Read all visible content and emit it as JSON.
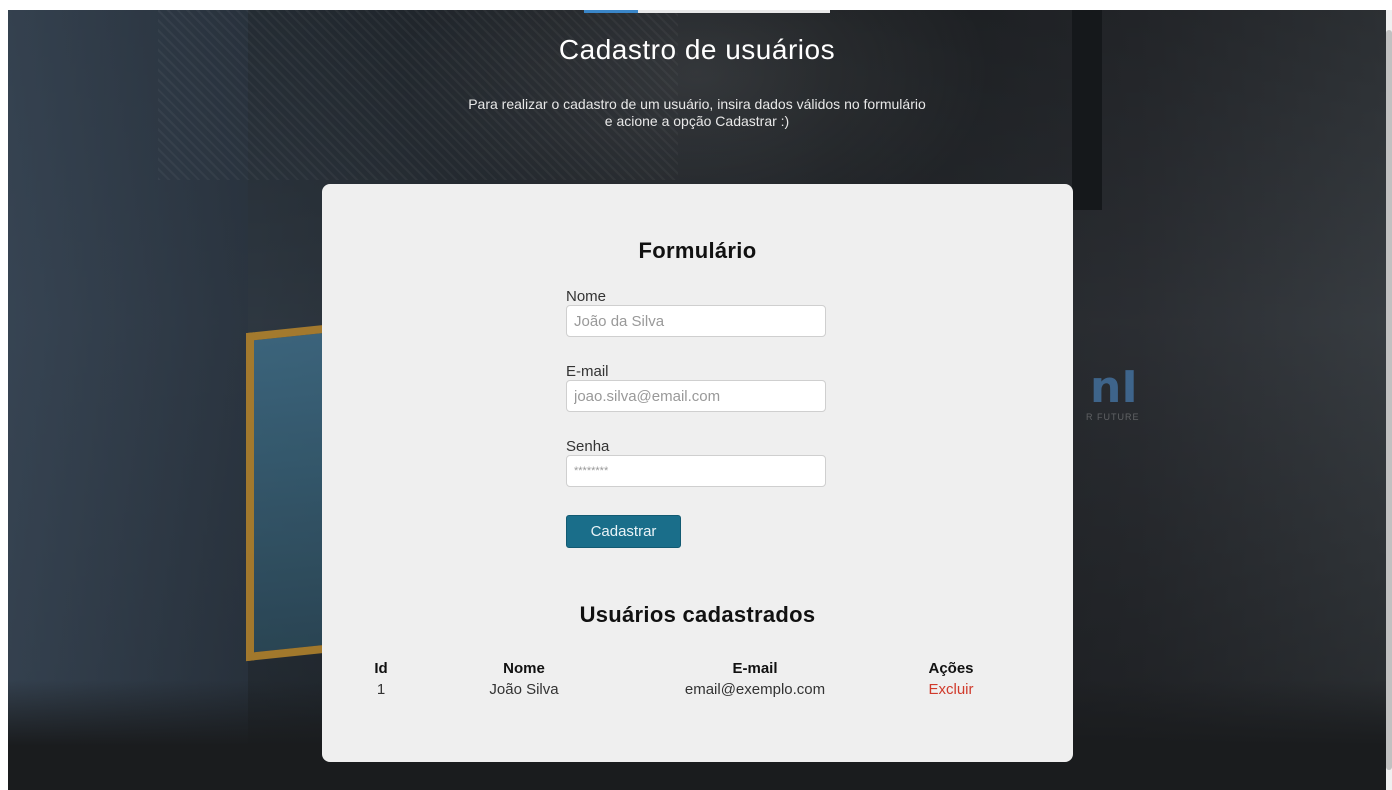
{
  "page": {
    "title": "Cadastro de usuários",
    "subtitle_line1": "Para realizar o cadastro de um usuário, insira dados válidos no formulário",
    "subtitle_line2": "e acione a opção Cadastrar :)"
  },
  "form": {
    "title": "Formulário",
    "fields": {
      "name": {
        "label": "Nome",
        "placeholder": "João da Silva",
        "value": ""
      },
      "email": {
        "label": "E-mail",
        "placeholder": "joao.silva@email.com",
        "value": ""
      },
      "password": {
        "label": "Senha",
        "placeholder": "********",
        "value": ""
      }
    },
    "submit_label": "Cadastrar"
  },
  "users": {
    "title": "Usuários cadastrados",
    "columns": [
      "Id",
      "Nome",
      "E-mail",
      "Ações"
    ],
    "rows": [
      {
        "id": "1",
        "name": "João Silva",
        "email": "email@exemplo.com",
        "action": "Excluir"
      }
    ]
  },
  "background": {
    "logo_text": "nI",
    "tagline": "R FUTURE"
  },
  "colors": {
    "button": "#1a6e8a",
    "delete_link": "#d03a2b",
    "card": "#efefef"
  }
}
